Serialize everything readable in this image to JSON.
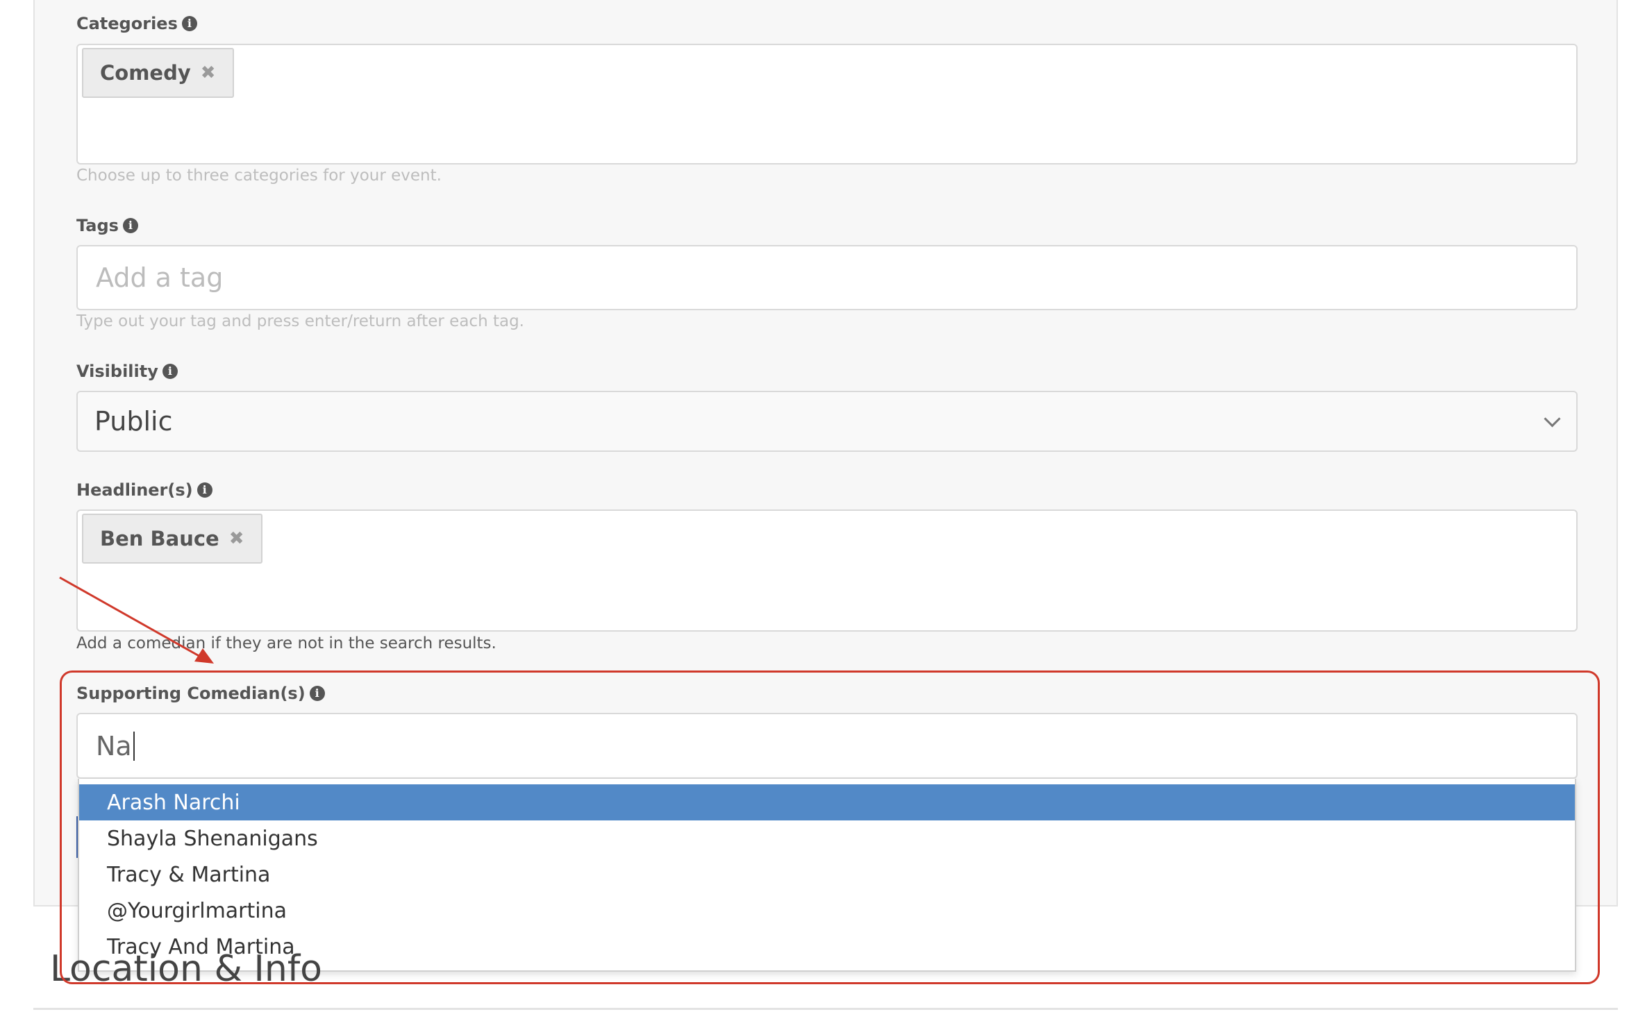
{
  "categories": {
    "label": "Categories",
    "chips": [
      "Comedy"
    ],
    "help": "Choose up to three categories for your event."
  },
  "tags": {
    "label": "Tags",
    "placeholder": "Add a tag",
    "help": "Type out your tag and press enter/return after each tag."
  },
  "visibility": {
    "label": "Visibility",
    "selected": "Public"
  },
  "headliners": {
    "label": "Headliner(s)",
    "chips": [
      "Ben Bauce"
    ],
    "help": "Add a comedian if they are not in the search results."
  },
  "supporting": {
    "label": "Supporting Comedian(s)",
    "value": "Na",
    "suggestions": [
      "Arash Narchi",
      "Shayla Shenanigans",
      "Tracy & Martina",
      "@Yourgirlmartina",
      "Tracy And Martina"
    ]
  },
  "section": {
    "title": "Location & Info"
  },
  "colors": {
    "highlight": "#d0392b",
    "active_option": "#5289c7"
  }
}
